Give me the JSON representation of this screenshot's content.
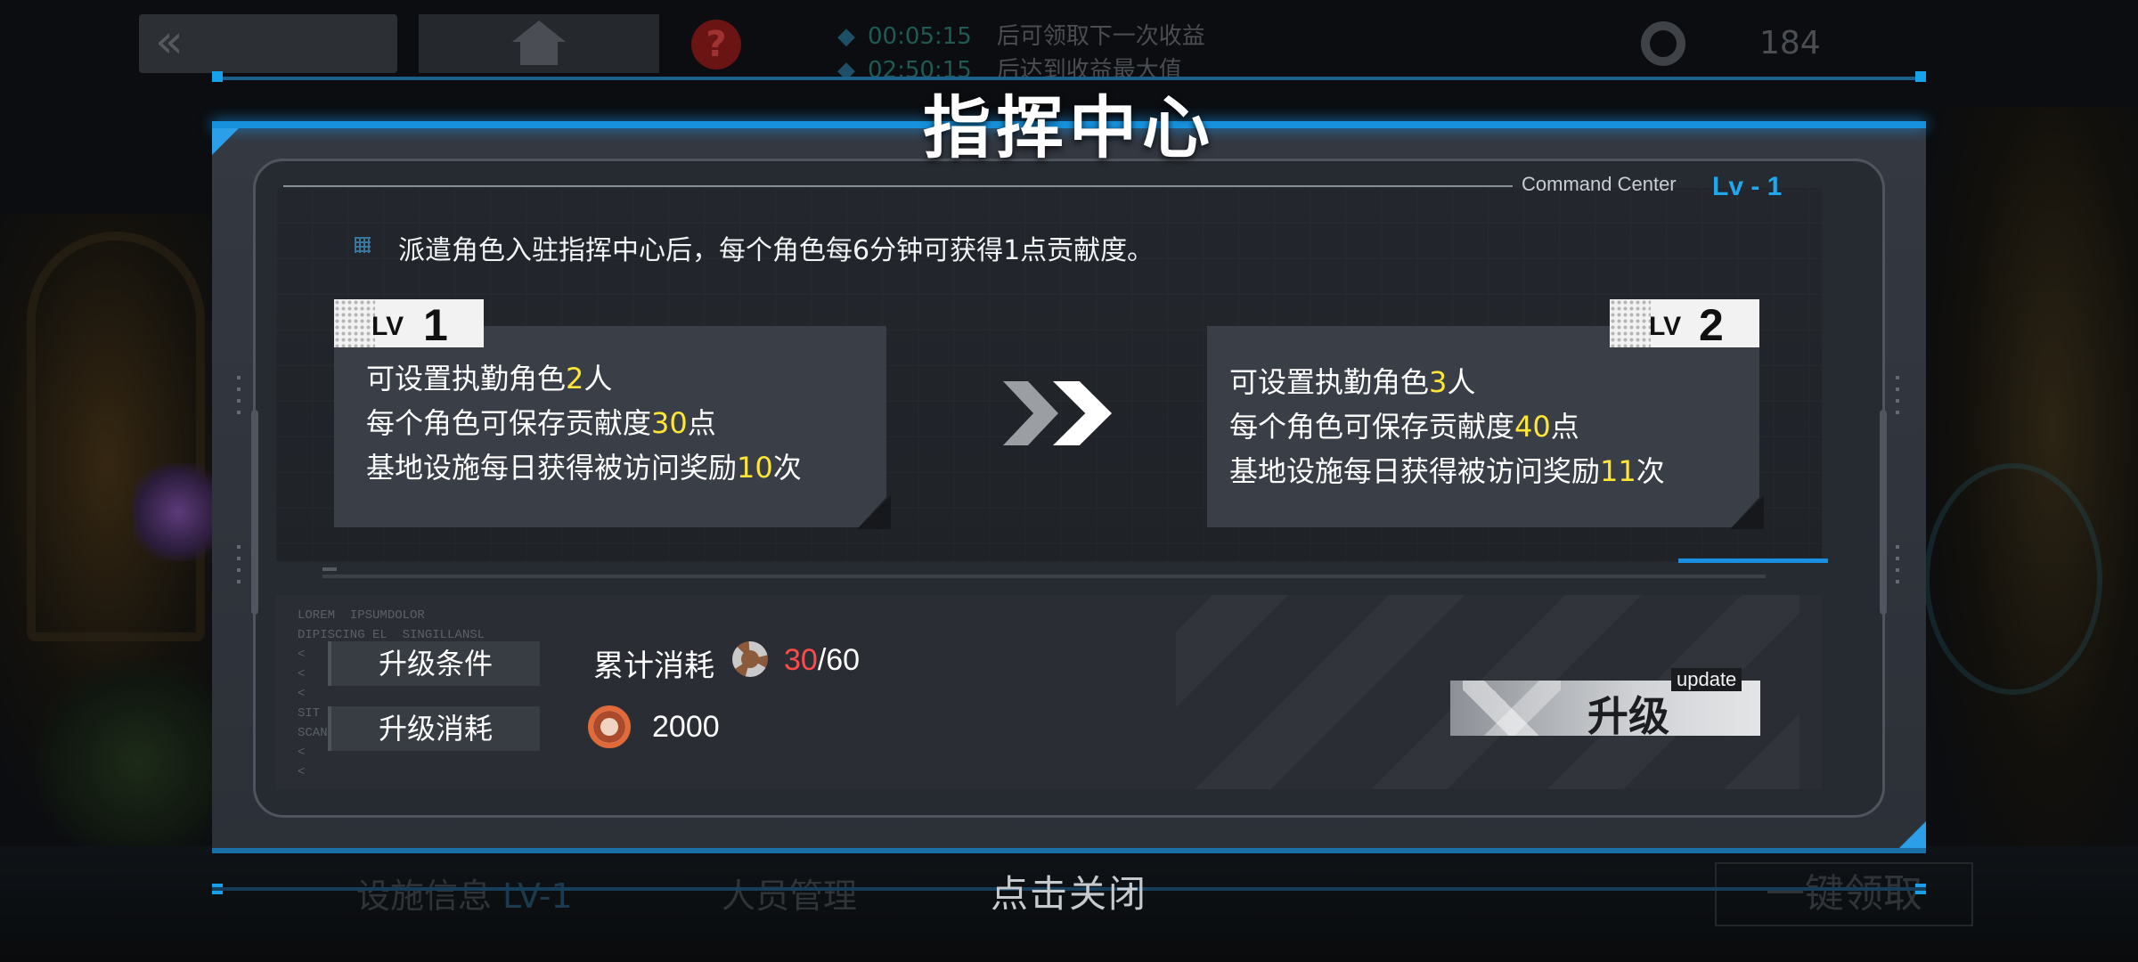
{
  "background_hud": {
    "back_icon": "double-chevron-left-icon",
    "home_icon": "home-icon",
    "help_icon": "question-mark-icon",
    "timer_rows": [
      {
        "time": "00:05:15",
        "text": "后可领取下一次收益"
      },
      {
        "time": "02:50:15",
        "text": "后达到收益最大值"
      }
    ],
    "currency_count": "184",
    "bottom_items": {
      "facility_info": "设施信息",
      "facility_level": "LV-1",
      "staff_management": "人员管理",
      "collect_all": "一键领取"
    }
  },
  "modal": {
    "title": "指挥中心",
    "subtitle_en": "Command Center",
    "level_label": "Lv - 1",
    "description": "派遣角色入驻指挥中心后，每个角色每6分钟可获得1点贡献度。",
    "current_level": {
      "tag_text": "LV",
      "tag_num": "1",
      "lines": [
        {
          "prefix": "可设置执勤角色",
          "value": "2",
          "suffix": "人"
        },
        {
          "prefix": "每个角色可保存贡献度",
          "value": "30",
          "suffix": "点"
        },
        {
          "prefix": "基地设施每日获得被访问奖励",
          "value": "10",
          "suffix": "次"
        }
      ]
    },
    "next_level": {
      "tag_text": "LV",
      "tag_num": "2",
      "lines": [
        {
          "prefix": "可设置执勤角色",
          "value": "3",
          "suffix": "人"
        },
        {
          "prefix": "每个角色可保存贡献度",
          "value": "40",
          "suffix": "点"
        },
        {
          "prefix": "基地设施每日获得被访问奖励",
          "value": "11",
          "suffix": "次"
        }
      ]
    },
    "lorem_text": "LOREM  IPSUMDOLOR\nDIPISCING EL  SINGILLANSL\n<\n<\n<\nSIT AMET, CONSECTET\nSCAN SERUM\n<\n<",
    "requirement_label": "升级条件",
    "requirement_text": "累计消耗",
    "requirement_current": "30",
    "requirement_total": "/60",
    "cost_label": "升级消耗",
    "cost_value": "2000",
    "upgrade_button": "升级",
    "upgrade_tag": "update",
    "close_hint": "点击关闭"
  },
  "colors": {
    "accent_blue": "#1fa8f0",
    "highlight_yellow": "#ffe536",
    "progress_red": "#ff4a4a"
  }
}
